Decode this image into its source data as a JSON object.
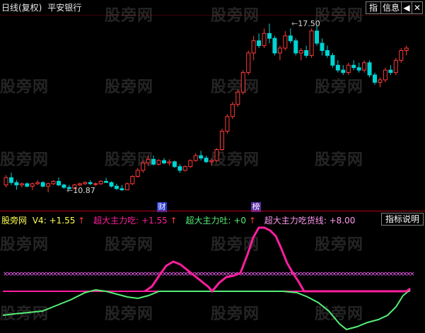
{
  "header": {
    "title": "日线(复权)",
    "stock": "平安银行",
    "buttons": {
      "indicator": "指",
      "info": "信息"
    }
  },
  "watermark": "股旁网",
  "price_panel": {
    "high_label": "17.50",
    "low_label": "10.87",
    "event_tags": [
      {
        "text": "财",
        "color": "#2a3bd6"
      },
      {
        "text": "榜",
        "color": "#5a2ca8"
      }
    ]
  },
  "indicator_panel": {
    "name": "股旁网",
    "v4_label": "V4:",
    "v4_value": "+1.55",
    "line1_label": "超大主力吃:",
    "line1_value": "+1.55",
    "line2_label": "超大主力吐:",
    "line2_value": "+0",
    "line3_label": "超大主力吃货线:",
    "line3_value": "+8.00",
    "help_button": "指标说明"
  },
  "colors": {
    "up": "#ff3b3b",
    "down": "#00d4d4",
    "magenta": "#ff1e9e",
    "green": "#55ee77",
    "cross": "#ff66ff",
    "yellow": "#ffff55"
  },
  "chart_data": {
    "type": "candlestick",
    "series": [
      {
        "name": "price",
        "values": [
          [
            10.9,
            11.3,
            10.8,
            11.2
          ],
          [
            11.2,
            11.4,
            10.9,
            11.0
          ],
          [
            11.0,
            11.1,
            10.7,
            10.9
          ],
          [
            10.9,
            11.0,
            10.8,
            10.95
          ],
          [
            10.95,
            11.0,
            10.8,
            10.85
          ],
          [
            10.85,
            11.0,
            10.7,
            10.95
          ],
          [
            10.95,
            11.1,
            10.9,
            11.0
          ],
          [
            11.0,
            11.05,
            10.8,
            10.85
          ],
          [
            10.85,
            11.0,
            10.6,
            10.95
          ],
          [
            10.95,
            11.1,
            10.9,
            11.05
          ],
          [
            11.05,
            11.2,
            10.85,
            10.9
          ],
          [
            10.9,
            10.95,
            10.75,
            10.8
          ],
          [
            10.8,
            10.9,
            10.7,
            10.75
          ],
          [
            10.75,
            10.95,
            10.87,
            10.9
          ],
          [
            10.9,
            11.0,
            10.85,
            10.95
          ],
          [
            10.95,
            11.05,
            10.9,
            11.0
          ],
          [
            11.0,
            11.1,
            10.9,
            10.95
          ],
          [
            10.95,
            11.0,
            10.85,
            10.95
          ],
          [
            10.95,
            11.1,
            10.9,
            11.05
          ],
          [
            11.05,
            11.2,
            11.0,
            11.0
          ],
          [
            11.0,
            11.05,
            10.8,
            10.85
          ],
          [
            10.85,
            10.95,
            10.7,
            10.75
          ],
          [
            10.75,
            10.9,
            10.65,
            10.7
          ],
          [
            10.7,
            11.0,
            10.7,
            10.95
          ],
          [
            10.95,
            11.3,
            10.9,
            11.25
          ],
          [
            11.25,
            11.6,
            11.2,
            11.5
          ],
          [
            11.5,
            11.9,
            11.4,
            11.8
          ],
          [
            11.8,
            12.1,
            11.7,
            11.95
          ],
          [
            11.95,
            12.1,
            11.7,
            11.75
          ],
          [
            11.75,
            11.95,
            11.7,
            11.9
          ],
          [
            11.9,
            12.0,
            11.75,
            11.8
          ],
          [
            11.8,
            11.95,
            11.7,
            11.85
          ],
          [
            11.85,
            11.9,
            11.6,
            11.65
          ],
          [
            11.65,
            11.75,
            11.4,
            11.5
          ],
          [
            11.5,
            11.7,
            11.45,
            11.65
          ],
          [
            11.65,
            11.95,
            11.6,
            11.9
          ],
          [
            11.9,
            12.2,
            11.85,
            12.1
          ],
          [
            12.1,
            12.3,
            11.9,
            12.0
          ],
          [
            12.0,
            12.1,
            11.8,
            11.85
          ],
          [
            11.85,
            12.0,
            11.7,
            11.9
          ],
          [
            11.9,
            12.4,
            11.85,
            12.35
          ],
          [
            12.35,
            13.2,
            12.3,
            13.1
          ],
          [
            13.1,
            13.8,
            13.0,
            13.7
          ],
          [
            13.7,
            14.3,
            13.6,
            14.2
          ],
          [
            14.2,
            14.8,
            14.1,
            14.7
          ],
          [
            14.7,
            15.6,
            14.6,
            15.5
          ],
          [
            15.5,
            16.4,
            15.4,
            16.3
          ],
          [
            16.3,
            17.0,
            16.0,
            16.8
          ],
          [
            16.8,
            17.1,
            16.5,
            16.6
          ],
          [
            16.6,
            17.3,
            16.5,
            17.1
          ],
          [
            17.1,
            17.5,
            16.7,
            16.9
          ],
          [
            16.9,
            17.0,
            16.2,
            16.3
          ],
          [
            16.3,
            16.6,
            16.0,
            16.5
          ],
          [
            16.5,
            17.2,
            16.4,
            17.0
          ],
          [
            17.0,
            17.3,
            16.7,
            16.8
          ],
          [
            16.8,
            16.9,
            16.2,
            16.3
          ],
          [
            16.3,
            16.5,
            16.0,
            16.4
          ],
          [
            16.4,
            16.6,
            16.1,
            16.2
          ],
          [
            16.2,
            17.3,
            16.1,
            17.2
          ],
          [
            17.2,
            17.4,
            16.6,
            16.7
          ],
          [
            16.7,
            16.9,
            16.2,
            16.4
          ],
          [
            16.4,
            16.6,
            16.1,
            16.2
          ],
          [
            16.2,
            16.3,
            15.7,
            15.8
          ],
          [
            15.8,
            16.0,
            15.5,
            15.6
          ],
          [
            15.6,
            15.8,
            15.4,
            15.5
          ],
          [
            15.5,
            15.9,
            15.4,
            15.8
          ],
          [
            15.8,
            16.0,
            15.6,
            15.7
          ],
          [
            15.7,
            15.9,
            15.5,
            15.6
          ],
          [
            15.6,
            16.0,
            15.5,
            15.9
          ],
          [
            15.9,
            16.0,
            15.3,
            15.4
          ],
          [
            15.4,
            15.5,
            15.0,
            15.1
          ],
          [
            15.1,
            15.3,
            14.9,
            15.2
          ],
          [
            15.2,
            15.7,
            15.1,
            15.6
          ],
          [
            15.6,
            15.8,
            15.4,
            15.5
          ],
          [
            15.5,
            16.1,
            15.4,
            16.0
          ],
          [
            16.0,
            16.5,
            15.9,
            16.4
          ],
          [
            16.4,
            16.6,
            16.2,
            16.5
          ]
        ]
      },
      {
        "name": "magenta",
        "values": [
          0,
          0,
          0,
          0,
          0,
          0,
          0,
          0,
          0,
          0,
          0,
          0,
          0,
          0,
          0,
          0,
          0,
          0,
          0,
          0,
          0,
          0,
          0,
          0,
          0,
          0,
          0,
          0,
          0,
          0,
          0,
          0,
          0,
          0,
          0,
          0,
          0,
          0,
          0,
          0,
          0,
          0,
          0,
          0,
          0,
          0,
          0,
          0,
          0,
          0,
          0,
          0,
          0,
          0,
          0,
          0,
          0,
          0,
          0,
          0,
          0,
          0,
          0,
          0,
          0,
          0,
          0,
          0,
          0,
          0,
          0,
          0,
          0,
          0,
          0,
          0,
          0
        ]
      },
      {
        "name": "green",
        "values": []
      },
      {
        "name": "cross",
        "values": []
      }
    ]
  }
}
